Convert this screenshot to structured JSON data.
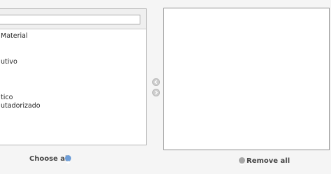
{
  "available": {
    "filter_value": "",
    "items": [
      "Material",
      "utivo",
      "tico",
      "utadorizado"
    ]
  },
  "actions": {
    "choose_all_label": "Choose all",
    "remove_all_label": "Remove all"
  },
  "icons": {
    "add": "add-circle-icon",
    "remove": "remove-circle-icon",
    "move_left": "arrow-left-icon",
    "move_right": "arrow-right-icon"
  },
  "colors": {
    "add_icon": "#6e9ed8",
    "remove_icon": "#a6a6a6"
  }
}
